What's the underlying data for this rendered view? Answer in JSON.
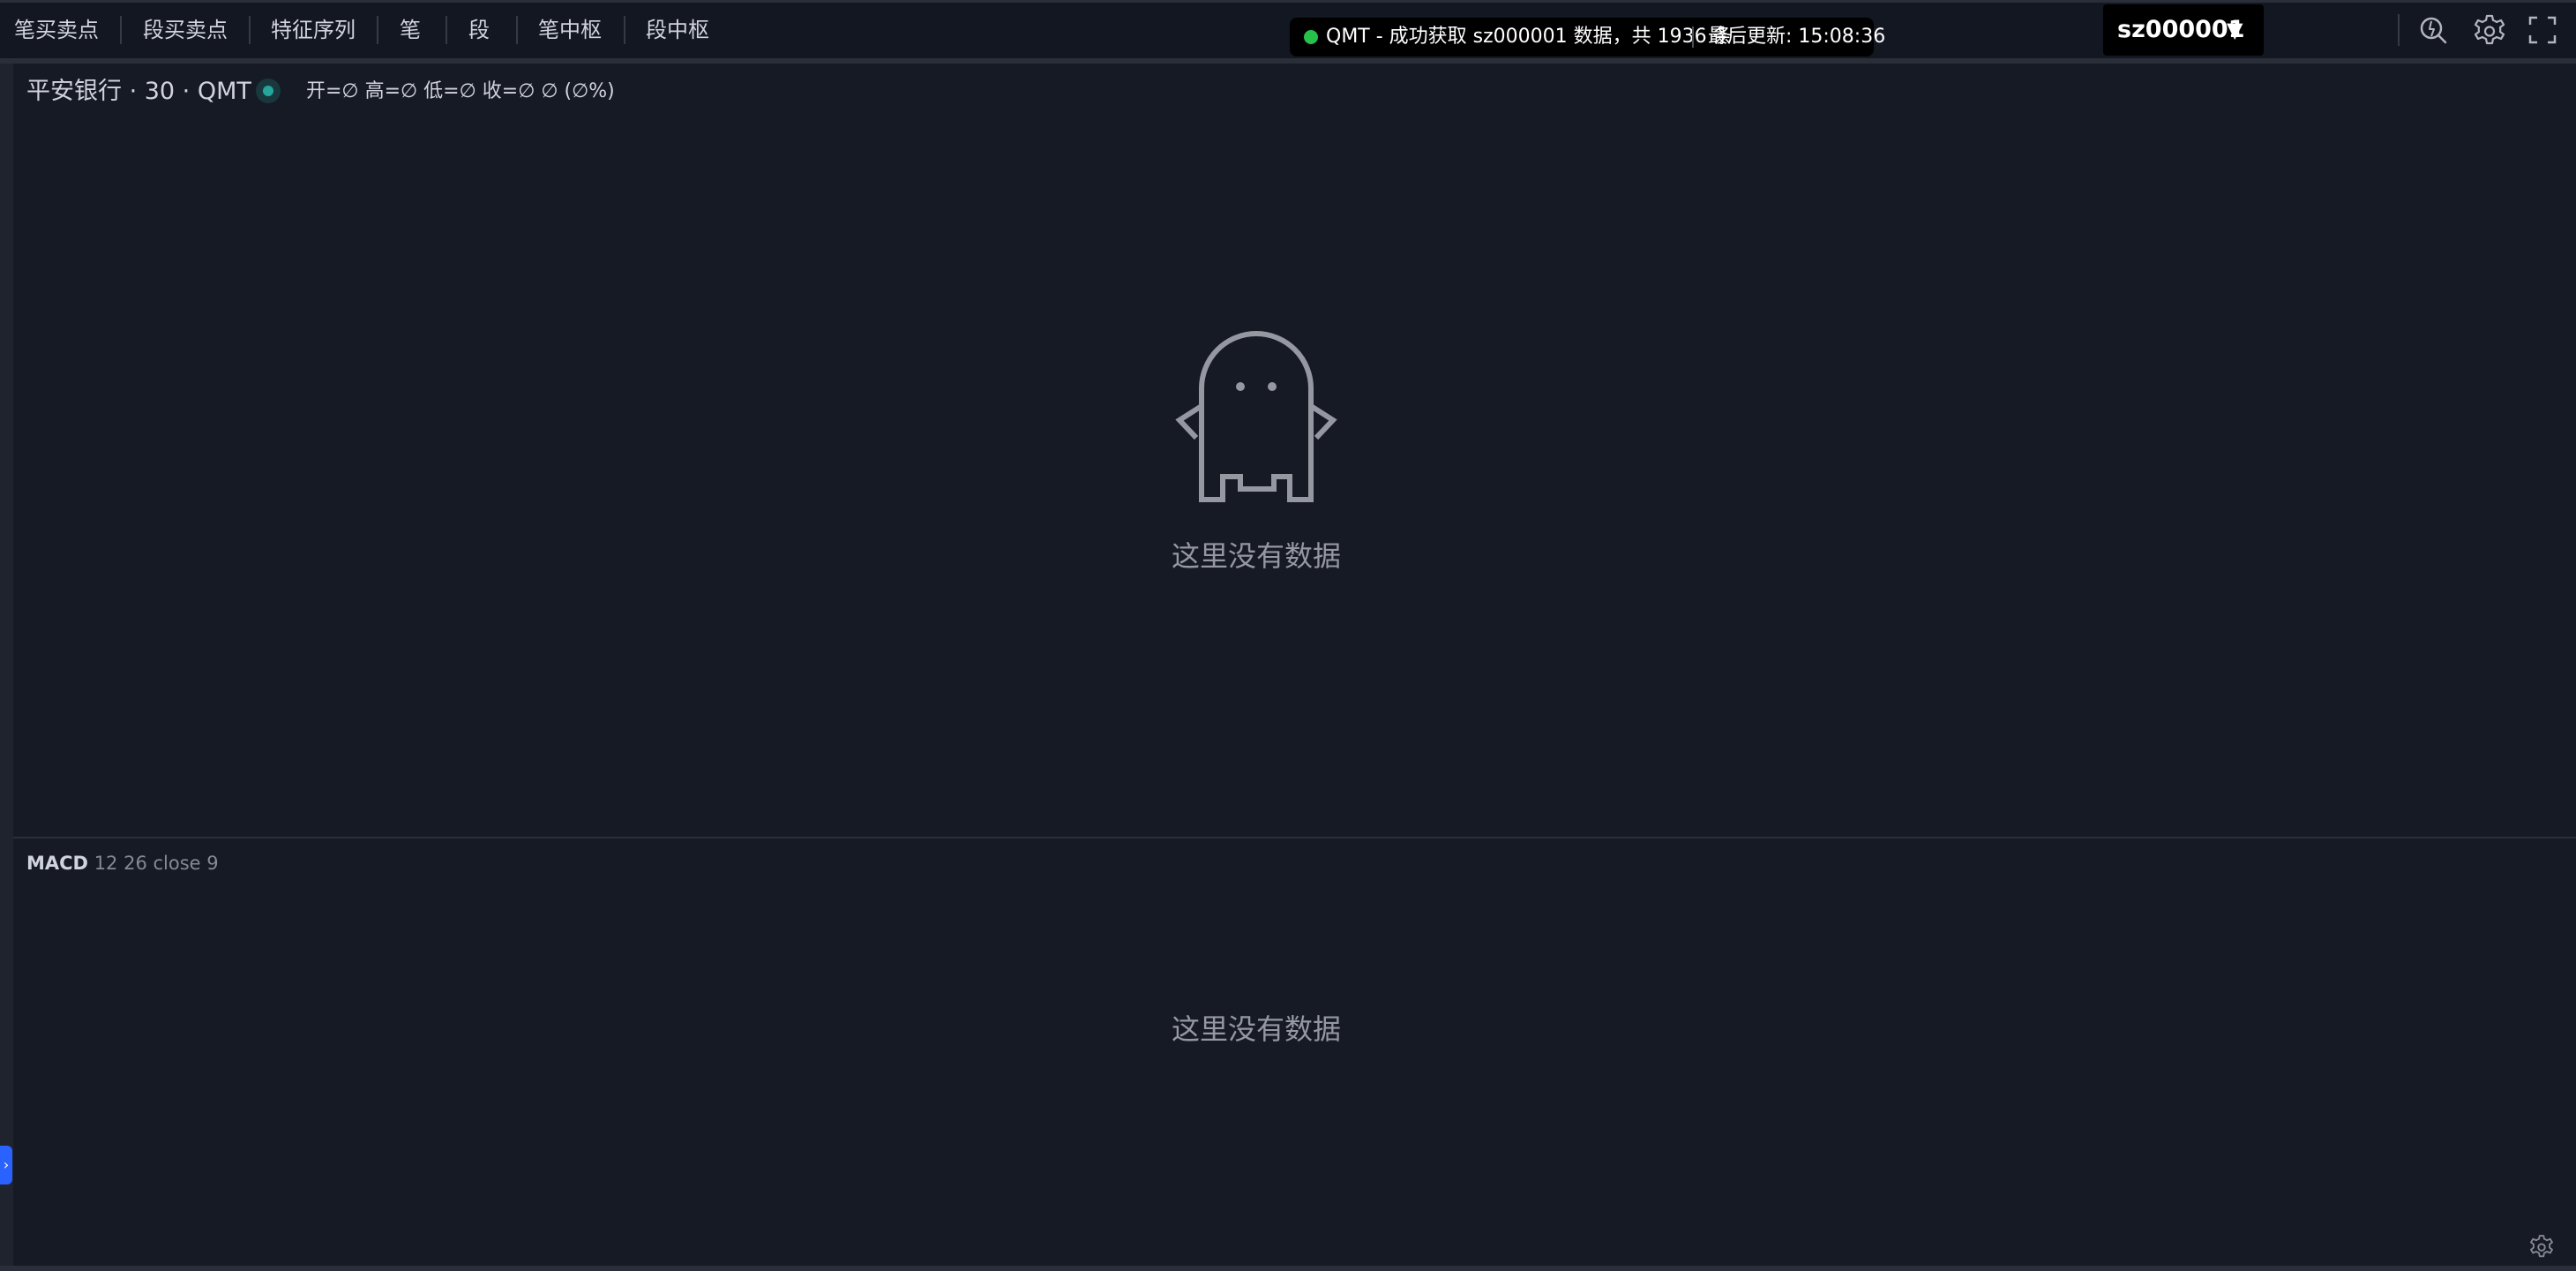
{
  "toolbar": {
    "items": [
      "笔买卖点",
      "段买卖点",
      "特征序列",
      "笔",
      "段",
      "笔中枢",
      "段中枢"
    ]
  },
  "status": {
    "message": "QMT - 成功获取 sz000001 数据，共 1936 条",
    "last_update": "最后更新: 15:08:36",
    "dot_color": "#26c04a"
  },
  "symbol_selector": {
    "value": "sz000001",
    "caret": "▼"
  },
  "toolbar_right": {
    "icons": [
      "quick-search-icon",
      "gear-icon",
      "fullscreen-icon"
    ]
  },
  "price_pane": {
    "title": "平安银行 · 30 · QMT",
    "ohlc": "开=∅  高=∅  低=∅  收=∅  ∅ (∅%)",
    "empty_text": "这里没有数据",
    "live_indicator_color": "#26a69a"
  },
  "macd_pane": {
    "name": "MACD",
    "params": "12 26 close 9",
    "empty_text": "这里没有数据"
  },
  "side_toggle": {
    "glyph": "›"
  },
  "colors": {
    "background": "#161a25",
    "toolbar": "#131722",
    "text": "#d1d4dc",
    "muted": "#9598a1",
    "accent": "#2962ff"
  }
}
